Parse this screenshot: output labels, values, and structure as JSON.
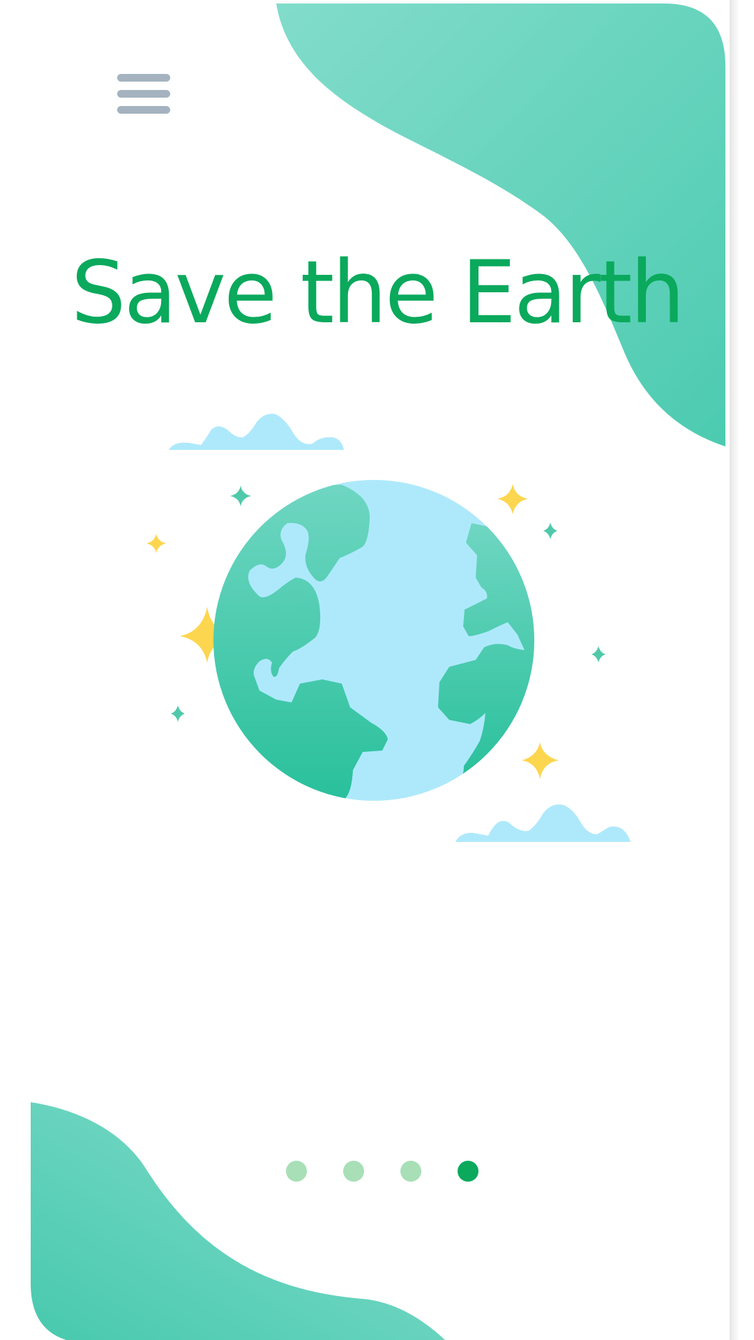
{
  "screen": {
    "title": "Save the Earth"
  },
  "menu": {
    "icon": "hamburger-menu-icon"
  },
  "pagination": {
    "total": 4,
    "current": 4
  },
  "colors": {
    "brand_green": "#0aa95c",
    "blob_teal": "#5fd3bc",
    "menu_gray": "#a4b3bf",
    "ocean_blue": "#aee9fb",
    "star_yellow": "#fdd64f",
    "dot_inactive": "#a8dfb7"
  },
  "illustration": {
    "icon": "earth-globe-icon"
  }
}
